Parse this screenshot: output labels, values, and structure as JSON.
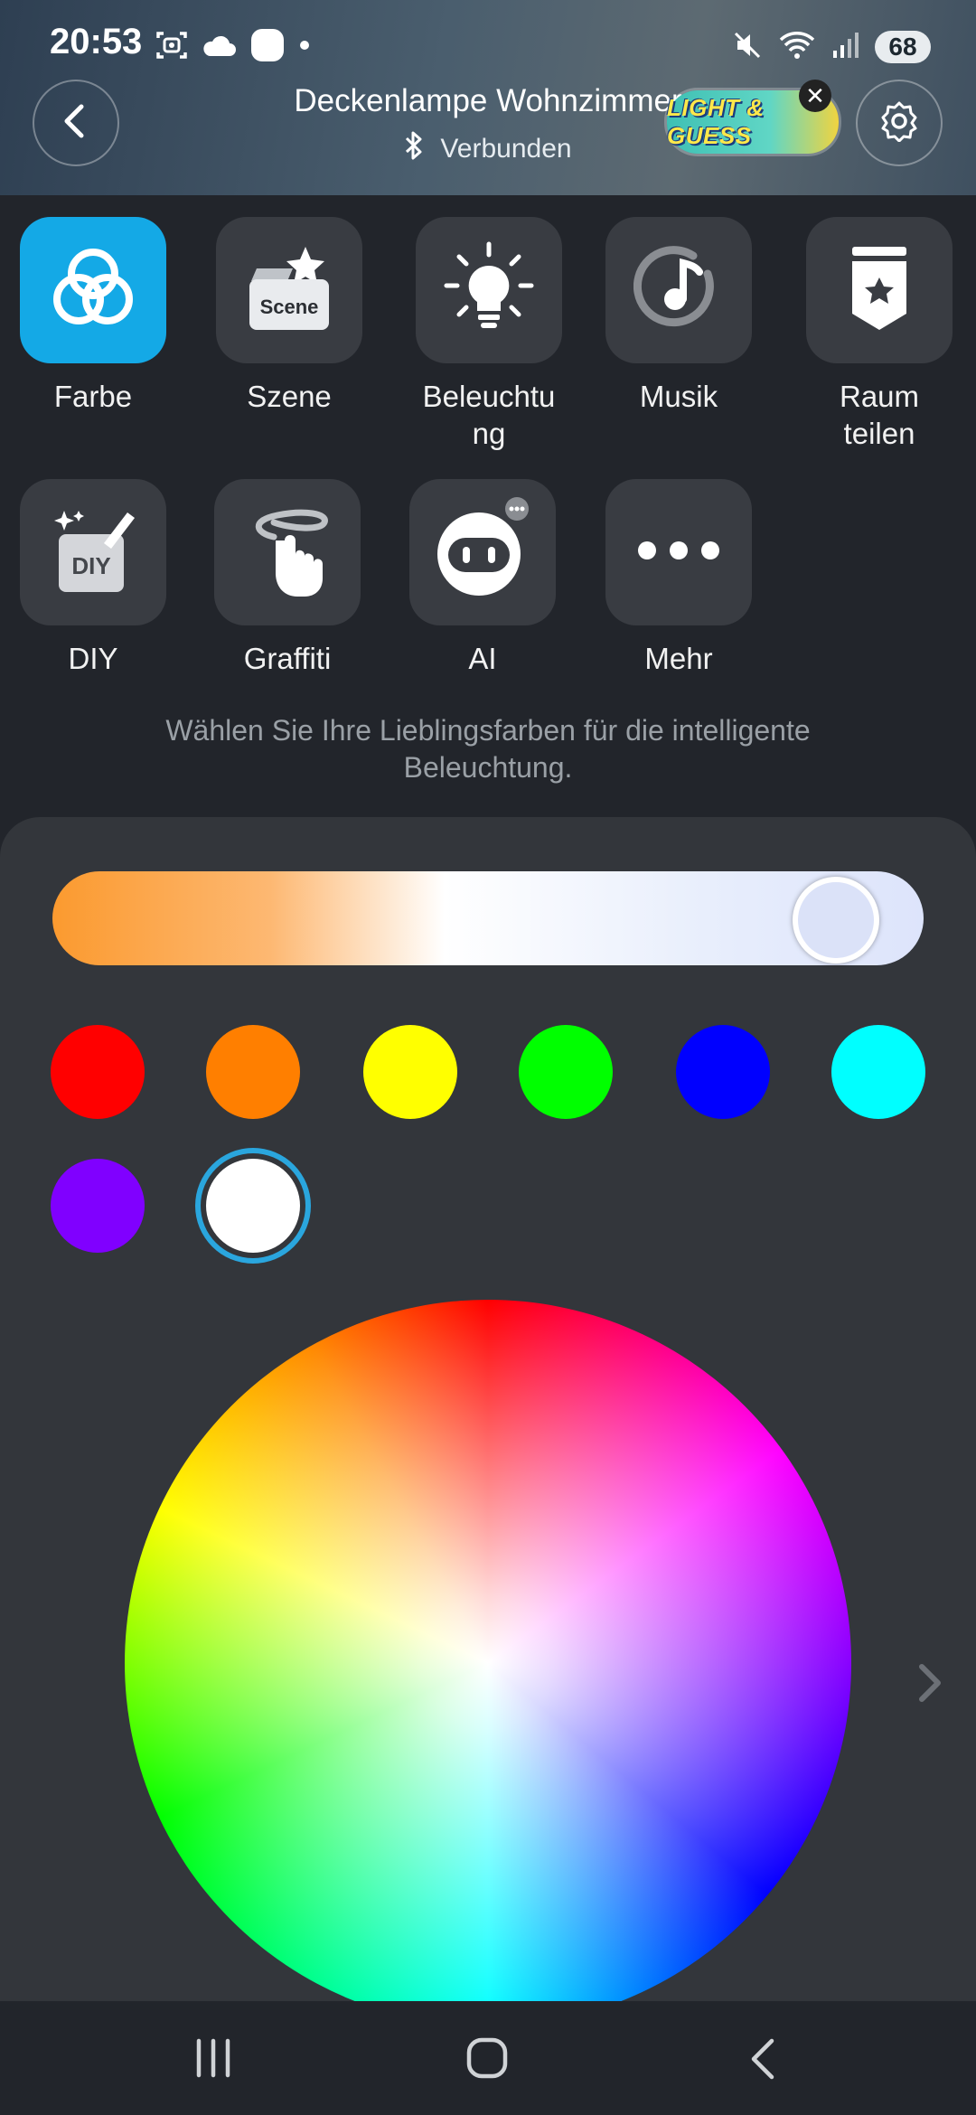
{
  "status_bar": {
    "time": "20:53",
    "battery": "68",
    "left_icons": [
      "screenshot-icon",
      "cloud-icon",
      "app-icon",
      "dot-icon"
    ],
    "right_icons": [
      "mute-icon",
      "wifi-icon",
      "signal-icon"
    ]
  },
  "header": {
    "title": "Deckenlampe Wohnzimmer",
    "connection_status": "Verbunden",
    "back_icon": "back-arrow-icon",
    "settings_icon": "gear-icon"
  },
  "promo": {
    "label": "LIGHT & GUESS",
    "close": "✕"
  },
  "modes": [
    {
      "id": "farbe",
      "label": "Farbe",
      "icon": "color-circles-icon",
      "active": true
    },
    {
      "id": "szene",
      "label": "Szene",
      "icon": "scene-icon",
      "icon_text": "Scene"
    },
    {
      "id": "beleuchtung",
      "label": "Beleuchtu\nng",
      "icon": "lightbulb-icon"
    },
    {
      "id": "musik",
      "label": "Musik",
      "icon": "music-icon"
    },
    {
      "id": "raum",
      "label": "Raum\nteilen",
      "icon": "badge-star-icon"
    },
    {
      "id": "diy",
      "label": "DIY",
      "icon": "diy-icon",
      "icon_text": "DIY"
    },
    {
      "id": "graffiti",
      "label": "Graffiti",
      "icon": "graffiti-icon"
    },
    {
      "id": "ai",
      "label": "AI",
      "icon": "robot-icon"
    },
    {
      "id": "mehr",
      "label": "Mehr",
      "icon": "more-icon"
    }
  ],
  "hint": "Wählen Sie Ihre Lieblingsfarben für die intelligente Beleuchtung.",
  "color_temperature": {
    "value_fraction": 0.95
  },
  "swatches": [
    {
      "color": "#ff0000"
    },
    {
      "color": "#ff7f00"
    },
    {
      "color": "#ffff00"
    },
    {
      "color": "#00ff00"
    },
    {
      "color": "#0000ff"
    },
    {
      "color": "#00ffff"
    },
    {
      "color": "#8000ff"
    },
    {
      "color": "#ffffff",
      "selected": true
    }
  ],
  "colors": {
    "accent": "#14a9e6",
    "background": "#22252b",
    "panel": "#33363b",
    "tile": "#393c42"
  },
  "nav": {
    "recent_icon": "recent-apps-icon",
    "home_icon": "home-icon",
    "back_icon": "nav-back-icon"
  }
}
